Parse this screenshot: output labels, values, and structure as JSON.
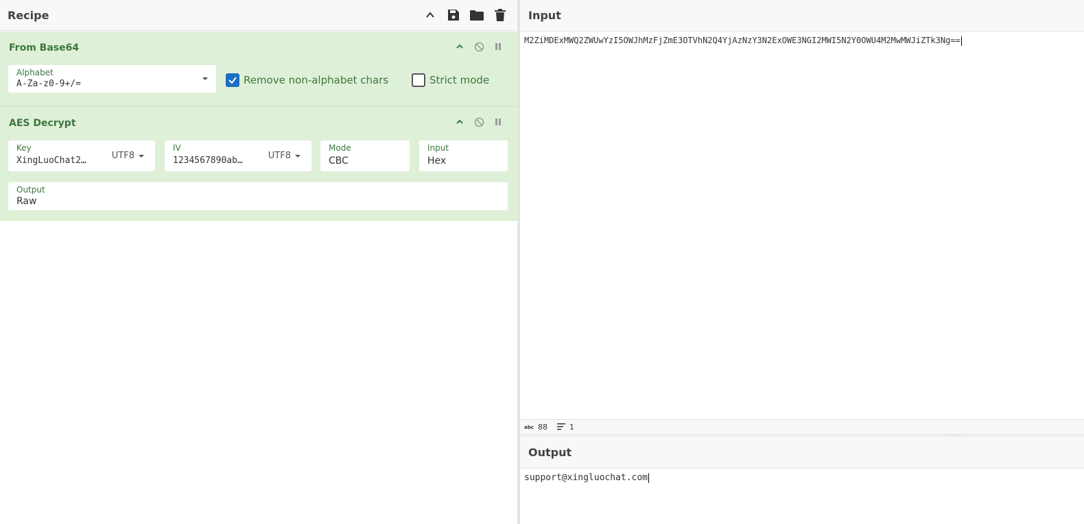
{
  "recipe": {
    "title": "Recipe",
    "operations": [
      {
        "name": "From Base64",
        "alphabet_label": "Alphabet",
        "alphabet_value": "A-Za-z0-9+/=",
        "remove_non_alpha_label": "Remove non-alphabet chars",
        "remove_non_alpha_checked": true,
        "strict_mode_label": "Strict mode",
        "strict_mode_checked": false
      },
      {
        "name": "AES Decrypt",
        "key_label": "Key",
        "key_value": "XingLuoChat2…",
        "key_encoding": "UTF8",
        "iv_label": "IV",
        "iv_value": "1234567890ab…",
        "iv_encoding": "UTF8",
        "mode_label": "Mode",
        "mode_value": "CBC",
        "input_label": "Input",
        "input_value": "Hex",
        "output_label": "Output",
        "output_value": "Raw"
      }
    ]
  },
  "input": {
    "title": "Input",
    "text": "M2ZiMDExMWQ2ZWUwYzI5OWJhMzFjZmE3OTVhN2Q4YjAzNzY3N2ExOWE3NGI2MWI5N2Y0OWU4M2MwMWJiZTk3Ng==",
    "status_length": "88",
    "status_lines": "1"
  },
  "output": {
    "title": "Output",
    "text": "support@xingluochat.com"
  },
  "colors": {
    "op_bg": "#dff0d8",
    "op_text": "#3c763d",
    "checkbox_checked": "#1b6fc0"
  }
}
